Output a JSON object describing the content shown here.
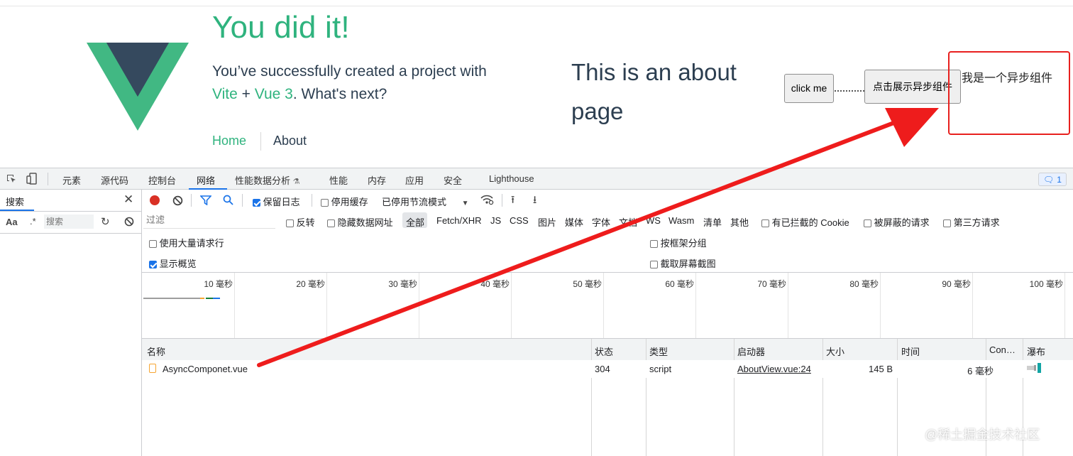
{
  "page": {
    "title": "You did it!",
    "subtitle_part1": "You’ve successfully created a project with",
    "subtitle_vite": "Vite",
    "subtitle_plus": "+",
    "subtitle_vue": "Vue 3",
    "subtitle_part2": ". What's next?",
    "nav": {
      "home": "Home",
      "about": "About"
    },
    "about_text": "This is an about page",
    "click_button": "click me",
    "async_button": "点击展示异步组件",
    "async_component_text": "我是一个异步组件"
  },
  "devtools": {
    "tabs": [
      "元素",
      "源代码",
      "控制台",
      "网络",
      "性能数据分析",
      "性能",
      "内存",
      "应用",
      "安全",
      "Lighthouse"
    ],
    "active_tab": "网络",
    "issues_count": "1",
    "search_panel": {
      "title": "搜索",
      "case_toggle": "Aa",
      "regex_toggle": ".*",
      "placeholder": "搜索"
    },
    "toolbar": {
      "preserve_log": "保留日志",
      "disable_cache": "停用缓存",
      "throttling": "已停用节流模式"
    },
    "filter": {
      "placeholder": "过滤",
      "invert": "反转",
      "hide_data_urls": "隐藏数据网址",
      "types": [
        "全部",
        "Fetch/XHR",
        "JS",
        "CSS",
        "图片",
        "媒体",
        "字体",
        "文档",
        "WS",
        "Wasm",
        "清单",
        "其他"
      ],
      "blocked_cookies": "有已拦截的 Cookie",
      "blocked_requests": "被屏蔽的请求",
      "third_party": "第三方请求"
    },
    "options": {
      "big_rows": "使用大量请求行",
      "show_overview": "显示概览",
      "group_by_frame": "按框架分组",
      "capture_screenshots": "截取屏幕截图"
    },
    "timeline_ticks": [
      "10 毫秒",
      "20 毫秒",
      "30 毫秒",
      "40 毫秒",
      "50 毫秒",
      "60 毫秒",
      "70 毫秒",
      "80 毫秒",
      "90 毫秒",
      "100 毫秒"
    ],
    "columns": [
      "名称",
      "状态",
      "类型",
      "启动器",
      "大小",
      "时间",
      "Con…",
      "瀑布"
    ],
    "rows": [
      {
        "name": "AsyncComponet.vue",
        "status": "304",
        "type": "script",
        "initiator": "AboutView.vue:24",
        "size": "145 B",
        "time": "6 毫秒"
      }
    ]
  },
  "watermark": "@稀土掘金技术社区",
  "colors": {
    "vue_green": "#2fb37e",
    "vue_dark": "#35495e",
    "annotation_red": "#e8201e",
    "devtools_blue": "#1a73e8"
  }
}
